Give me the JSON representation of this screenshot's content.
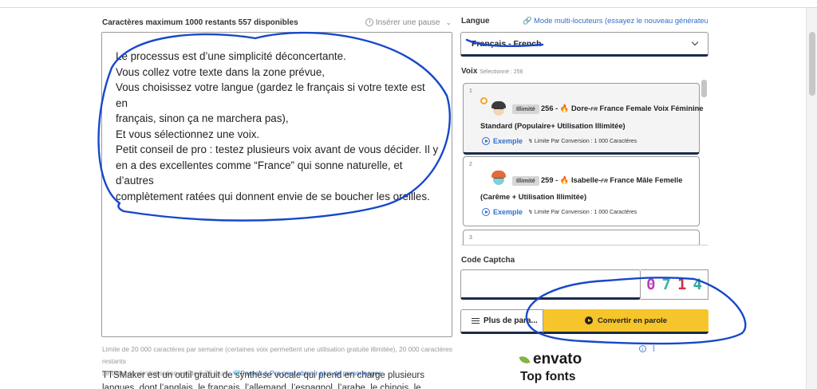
{
  "editor": {
    "char_count": "Caractères maximum 1000 restants 557 disponibles",
    "pause_label": "Insérer une pause",
    "text_lines": [
      "Le processus est d’une simplicité déconcertante.",
      "",
      "Vous collez votre texte dans la zone prévue,",
      "Vous choisissez votre langue (gardez le français si votre texte est en",
      "français, sinon ça ne marchera pas),",
      "Et vous sélectionnez une voix.",
      "Petit conseil de pro : testez plusieurs voix avant de vous décider. Il y",
      "en a des excellentes comme “France” qui sonne naturelle, et d’autres",
      "complètement ratées qui donnent envie de se boucher les oreilles."
    ],
    "limit_note": "Limite de 20 000 caractères par semaine (certaines voix permettent une utilisation gratuite illimitée), 20 000 caractères restants",
    "reset_note": "Le délai de réinitialisation est de 6,79 jours.",
    "pro_link": "💎Passez à Pro",
    "pro_note": " pour obtenir plus de personnages.",
    "description": "TTSMaker est un outil gratuit de synthèse vocale qui prend en charge plusieurs langues, dont l’anglais, le français, l’allemand, l’espagnol, l’arabe, le chinois, le japonais, le coréen, le"
  },
  "language": {
    "label": "Langue",
    "multi_speaker_link": "🔗 Mode multi-locuteurs (essayez le nouveau générateur de ...",
    "selected": "Français - French"
  },
  "voices": {
    "label": "Voix",
    "selected_count": "Sélectionné : 256",
    "items": [
      {
        "index": "1",
        "badge": "Illimité",
        "title_prefix": "256 - ",
        "fire": "🔥",
        "name": "Dore-",
        "flag": "FR",
        "title_rest": " France Female Voix Féminine",
        "subtitle": "Standard (Populaire+ Utilisation Illimitée)",
        "exemple": "Exemple",
        "limit": "Limite Par Conversion : 1 000 Caractères",
        "selected": true
      },
      {
        "index": "2",
        "badge": "Illimité",
        "title_prefix": "259 - ",
        "fire": "🔥",
        "name": "Isabelle-",
        "flag": "FR",
        "title_rest": " France Mâle Femelle",
        "subtitle": "(Carême + Utilisation Illimitée)",
        "exemple": "Exemple",
        "limit": "Limite Par Conversion : 1 000 Caractères",
        "selected": false
      },
      {
        "index": "3"
      }
    ]
  },
  "captcha": {
    "label": "Code Captcha",
    "chars": [
      "0",
      "7",
      "1",
      "4"
    ],
    "colors": [
      "#b83db5",
      "#3bb3a8",
      "#d2334a",
      "#2fa7a0"
    ]
  },
  "actions": {
    "more_label": "Plus de para...",
    "convert_label": "Convertir en parole"
  },
  "ad": {
    "brand": "envato",
    "title": "Top fonts",
    "info_icon": "i",
    "more_icon": "⋮"
  },
  "colors": {
    "accent_yellow": "#f6c52b",
    "link_blue": "#2f6fcb",
    "annotation_blue": "#1748c9"
  }
}
